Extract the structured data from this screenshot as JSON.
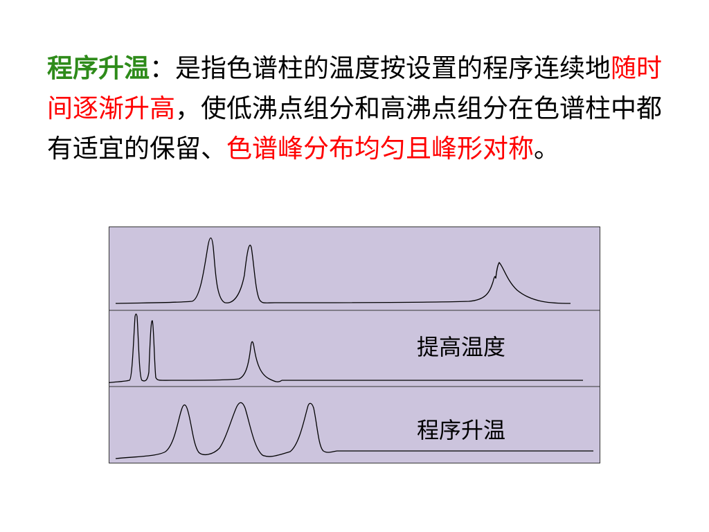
{
  "slide": {
    "term": "程序升温",
    "colon": "：",
    "line1_rest": "是指色谱柱的温度按设置的程序连续地",
    "highlight1": "随时间逐渐升高",
    "middle": "，使低沸点组分和高沸点组分在色谱柱中都有适宜的保留、",
    "highlight2": "色谱峰分布均匀且峰形对称",
    "end": "。"
  },
  "figure": {
    "panels": [
      {
        "label": ""
      },
      {
        "label": "提高温度"
      },
      {
        "label": "程序升温"
      }
    ],
    "colors": {
      "background": "#ccc4dd",
      "border": "#333333",
      "trace": "#000000",
      "term": "#2e8b1a",
      "highlight": "#ff0000"
    }
  }
}
